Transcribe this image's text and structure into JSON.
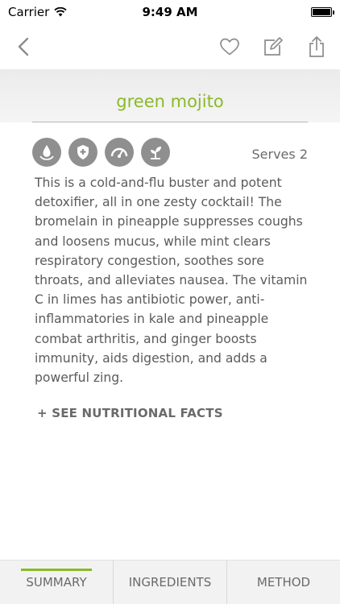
{
  "status_bar": {
    "carrier": "Carrier",
    "time": "9:49 AM"
  },
  "recipe": {
    "title": "green mojito",
    "serves": "Serves 2",
    "description": "This is a cold-and-flu buster and potent detoxifier, all in one zesty cocktail! The bromelain in pineapple suppresses coughs and loosens mucus, while mint clears respiratory congestion, soothes sore throats, and alleviates nausea. The vitamin C in limes has antibiotic power, anti-inflammatories in kale and pineapple combat arthritis, and ginger boosts immunity, aids digestion, and adds a powerful zing.",
    "nutrition_link": "+ SEE NUTRITIONAL FACTS",
    "badges": [
      "water-drop-icon",
      "shield-plus-icon",
      "gauge-icon",
      "sprout-icon"
    ]
  },
  "tabs": {
    "summary": "SUMMARY",
    "ingredients": "INGREDIENTS",
    "method": "METHOD",
    "active": "summary"
  },
  "colors": {
    "accent": "#8ab929",
    "badge": "#8f8f8f",
    "text": "#5b5b5b"
  }
}
